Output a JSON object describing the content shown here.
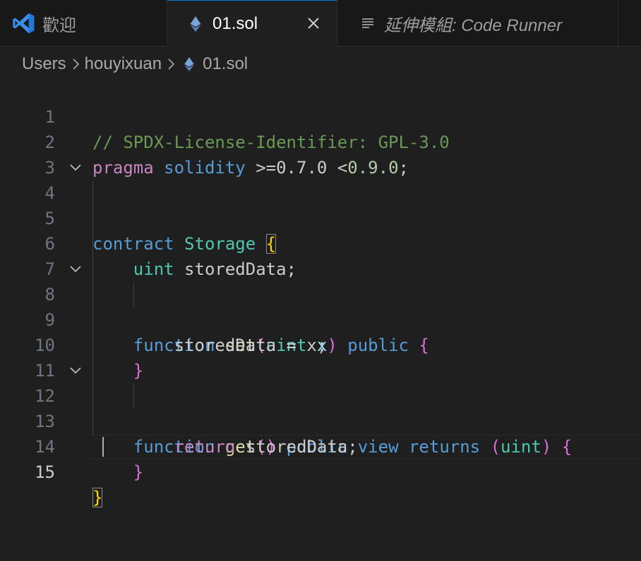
{
  "tabs": {
    "welcome": "歡迎",
    "active": "01.sol",
    "extension": "延伸模組: Code Runner"
  },
  "breadcrumb": [
    "Users",
    "houyixuan",
    "01.sol"
  ],
  "editor": {
    "active_line": "15",
    "line_numbers": [
      "1",
      "2",
      "3",
      "4",
      "5",
      "6",
      "7",
      "8",
      "9",
      "10",
      "11",
      "12",
      "13",
      "14",
      "15"
    ],
    "lines": {
      "l1_comment": "// SPDX-License-Identifier: GPL-3.0",
      "l2_pragma": "pragma",
      "l2_solidity": "solidity",
      "l2_ge": ">=",
      "l2_v1": "0.7.0",
      "l2_lt": "<",
      "l2_v2": "0.9.0",
      "l2_semi": ";",
      "l4_contract": "contract",
      "l4_name": "Storage",
      "l4_brace": "{",
      "l6_type": "uint",
      "l6_rest": "storedData;",
      "l8_function": "function",
      "l8_name": "set",
      "l8_open": "(",
      "l8_type": "uint",
      "l8_param": "x",
      "l8_close": ")",
      "l8_public": "public",
      "l8_brace": "{",
      "l9_stmt": "storedData = x;",
      "l10_brace": "}",
      "l12_function": "function",
      "l12_name": "get",
      "l12_parens": "()",
      "l12_public": "public",
      "l12_view": "view",
      "l12_returns": "returns",
      "l12_open": "(",
      "l12_type": "uint",
      "l12_close": ")",
      "l12_brace": "{",
      "l13_return": "return",
      "l13_rest": "storedData;",
      "l14_brace": "}",
      "l15_brace": "}"
    }
  },
  "colors": {
    "accent": "#0078d4",
    "comment": "#6a9955",
    "keyword": "#569cd6",
    "control": "#c586c0",
    "type": "#4ec9b0",
    "function": "#dcdcaa",
    "number": "#b5cea8",
    "bracket_gold": "#ffd700",
    "bracket_pink": "#da70d6"
  },
  "icons": {
    "app": "vscode-icon",
    "file": "ethereum-icon",
    "close": "close-icon",
    "preview": "lines-icon",
    "fold": "chevron-down-icon",
    "separator": "chevron-right-icon"
  }
}
